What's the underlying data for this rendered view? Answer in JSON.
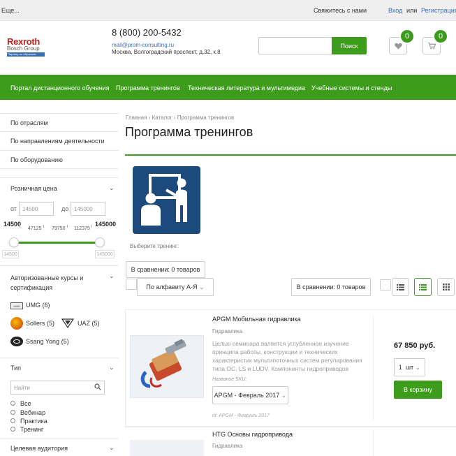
{
  "topbar": {
    "more": "Еще...",
    "contact": "Свяжитесь с нами",
    "login": "Вход",
    "or": "или",
    "register": "Регистрация"
  },
  "header": {
    "logo_main": "Rexroth",
    "logo_sub": "Bosch Group",
    "logo_tag": "Партнер по обучению",
    "phone": "8 (800) 200-5432",
    "email": "mail@prom-consulting.ru",
    "address": "Москва, Волгоградский проспект, д.32, к.8",
    "search_button": "Поиск",
    "favorites_count": "0",
    "cart_count": "0"
  },
  "nav": {
    "items": [
      "Портал дистанционного обучения",
      "Программа тренингов",
      "Техническая литература и мультимедиа",
      "Учебные системы и стенды"
    ]
  },
  "sidebar": {
    "links": [
      "По отраслям",
      "По направлениям деятельности",
      "По оборудованию"
    ],
    "price": {
      "title": "Розничная цена",
      "from_label": "от",
      "to_label": "до",
      "from_placeholder": "14500",
      "to_placeholder": "145000",
      "min": "14500",
      "max": "145000",
      "ticks": [
        "47125",
        "79750",
        "112375"
      ],
      "min_small": "14500",
      "max_small": "145000"
    },
    "authorized": {
      "title": "Авторизованные курсы и сертификация",
      "brands": [
        {
          "name": "UMG",
          "count": "(6)"
        },
        {
          "name": "Sollers",
          "count": "(5)"
        },
        {
          "name": "UAZ",
          "count": "(5)"
        },
        {
          "name": "Ssang Yong",
          "count": "(5)"
        }
      ]
    },
    "type": {
      "title": "Тип",
      "search_placeholder": "Найти",
      "options": [
        "Все",
        "Вебинар",
        "Практика",
        "Тренинг"
      ]
    },
    "audience_title": "Целевая аудитория"
  },
  "main": {
    "breadcrumbs": [
      "Главная",
      "Каталог",
      "Программа тренингов"
    ],
    "title": "Программа тренингов",
    "select_training": "Выберите тренинг:",
    "compare_top": "В сравнении: 0 товаров",
    "sort_label": "По алфавиту А-Я",
    "compare_right": "В сравнении: 0 товаров",
    "products": [
      {
        "title": "APGM Мобильная гидравлика",
        "category": "Гидравлика",
        "desc": "Целью семинара является углубленное изучение принципа работы, конструкции и технических характеристик мультипоточных систем регулирования типа OC, LS и LUDV. Компоненты гидроприводов",
        "sku_label": "Название SKU:",
        "sku_value": "APGM - Февраль 2017",
        "id": "id: APGM - Февраль 2017",
        "price": "67 850 руб.",
        "qty": "1",
        "unit": "шт",
        "cart_button": "В корзину"
      },
      {
        "title": "HTG Основы гидропривода",
        "category": "Гидравлика"
      }
    ]
  }
}
